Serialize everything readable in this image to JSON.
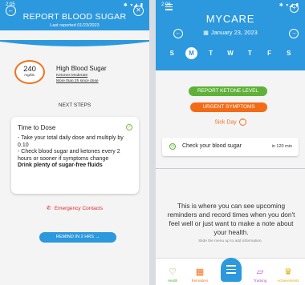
{
  "left": {
    "status_time": "2:05",
    "status_icons": "✱ ▾◢ ▮",
    "header": {
      "title": "REPORT BLOOD SUGAR",
      "subtitle": "Last reported 01/23/2023"
    },
    "reading": {
      "value": "240",
      "unit": "mg/DL"
    },
    "summary": {
      "heading": "High Blood Sugar",
      "ketones": "Ketones Moderate",
      "since": "More than 2h since dose"
    },
    "next_steps_label": "NEXT STEPS",
    "card": {
      "title": "Time to Dose",
      "line1": "- Take your total daily dose and multiply by 0.10",
      "line2": "- Check blood sugar and ketones every 2 hours or sooner if symptoms change",
      "line3": "Drink plenty of sugar-free fluids"
    },
    "emergency_label": "Emergency Contacts",
    "remind_label": "REMIND IN 2 HRS →",
    "colors": {
      "primary": "#2c98dd",
      "high": "#f0731f",
      "alert": "#e12c2c"
    }
  },
  "right": {
    "status_time": "2:06",
    "status_icons": "✱ ▾◢ ▮",
    "title": "MYCARE",
    "date": "January 23, 2023",
    "week": [
      "S",
      "M",
      "T",
      "W",
      "T",
      "F",
      "S"
    ],
    "selected_day_index": 1,
    "ketone_button": "REPORT KETONE LEVEL",
    "urgent_button": "URGENT SYMPTOMS",
    "sick_day_label": "Sick Day",
    "reminder": {
      "text": "Check your blood sugar",
      "when": "in 120 min"
    },
    "info_text": "This is where you can see upcoming reminders and record times when you don't feel well or just want to make a note about your health.",
    "slide_hint": "Slide the menu up to add information.",
    "nav": [
      {
        "label": "Health",
        "icon": "heart-diamond-icon"
      },
      {
        "label": "Reminders",
        "icon": "calendar-icon"
      },
      {
        "label": "",
        "icon": "menu-icon"
      },
      {
        "label": "Tracking",
        "icon": "chart-icon"
      },
      {
        "label": "Achievements",
        "icon": "trophy-icon"
      }
    ],
    "colors": {
      "primary": "#2c98dd",
      "ketone": "#5fb139",
      "urgent": "#f46b17"
    }
  }
}
